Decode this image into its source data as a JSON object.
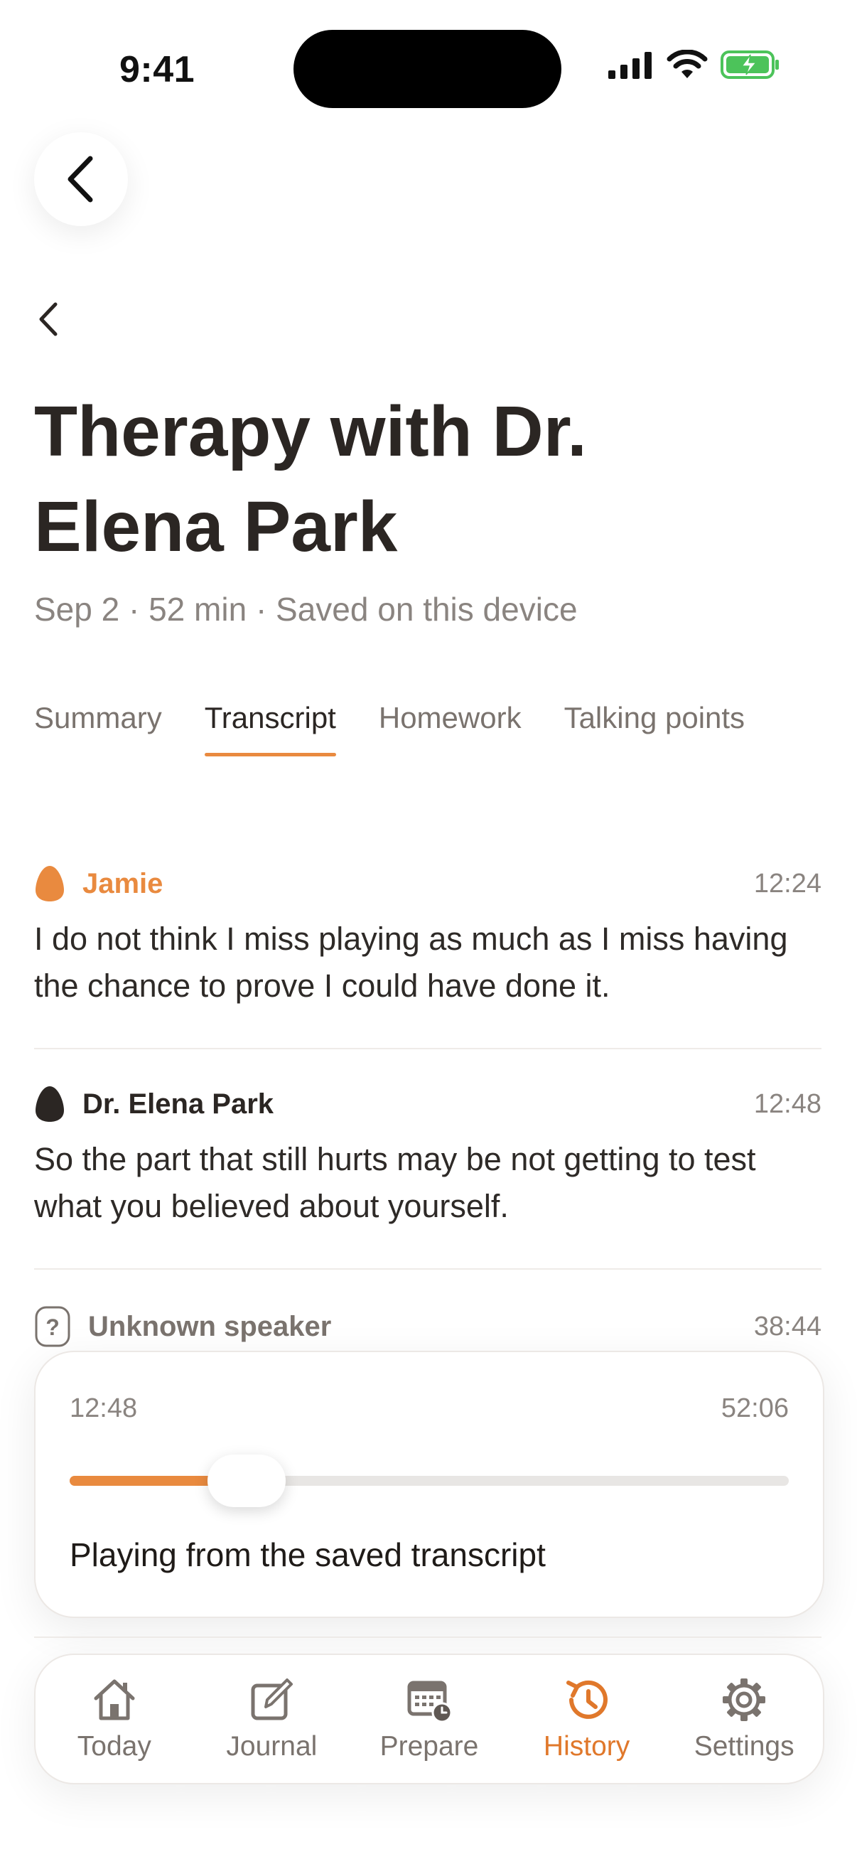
{
  "status": {
    "time": "9:41"
  },
  "header": {
    "title_line1": "Therapy with Dr.",
    "title_line2": "Elena Park",
    "meta": "Sep 2 · 52 min · Saved on this device"
  },
  "tabs": [
    {
      "label": "Summary",
      "active": false
    },
    {
      "label": "Transcript",
      "active": true
    },
    {
      "label": "Homework",
      "active": false
    },
    {
      "label": "Talking points",
      "active": false
    }
  ],
  "transcript": [
    {
      "speaker": "Jamie",
      "time": "12:24",
      "text": "I do not think I miss playing as much as I miss having the chance to prove I could have done it.",
      "color": "#e98a3f"
    },
    {
      "speaker": "Dr. Elena Park",
      "time": "12:48",
      "text": "So the part that still hurts may be not getting to test what you believed about yourself.",
      "color": "#2b2623"
    },
    {
      "speaker": "Unknown speaker",
      "time": "38:44",
      "icon": "question-mark-icon",
      "color": "#7a736e"
    }
  ],
  "player": {
    "current_time": "12:48",
    "total_time": "52:06",
    "progress": 0.246,
    "caption": "Playing from the saved transcript",
    "accent": "#e98a3f"
  },
  "nav": [
    {
      "label": "Today",
      "icon": "house-icon",
      "active": false
    },
    {
      "label": "Journal",
      "icon": "edit-icon",
      "active": false
    },
    {
      "label": "Prepare",
      "icon": "calendar-clock-icon",
      "active": false
    },
    {
      "label": "History",
      "icon": "history-icon",
      "active": true
    },
    {
      "label": "Settings",
      "icon": "gear-icon",
      "active": false
    }
  ]
}
